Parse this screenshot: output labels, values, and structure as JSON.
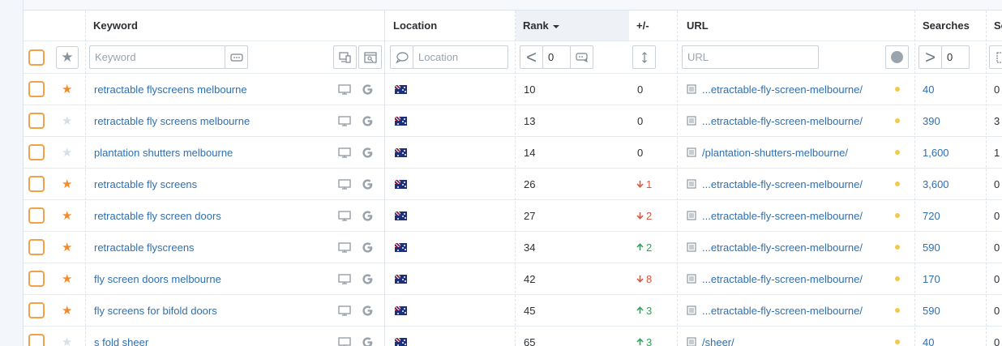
{
  "header": {
    "keyword": "Keyword",
    "location": "Location",
    "rank": "Rank",
    "change": "+/-",
    "url": "URL",
    "searches": "Searches",
    "extra": "Sc"
  },
  "filters": {
    "keyword_placeholder": "Keyword",
    "location_placeholder": "Location",
    "rank_operator": "<",
    "rank_value": "0",
    "url_placeholder": "URL",
    "searches_operator": ">",
    "searches_value": "0"
  },
  "colors": {
    "accent_orange": "#f08c2e",
    "link_blue": "#2f6fb0",
    "down_red": "#e0533f",
    "up_green": "#2ea35b",
    "dot_yellow": "#f3c94a"
  },
  "icons": {
    "device": "desktop-icon",
    "engine": "google-icon",
    "location_flag": "australia-flag-icon",
    "url_doc": "document-icon"
  },
  "rows": [
    {
      "keyword": "retractable flyscreens melbourne",
      "starred": true,
      "rank": "10",
      "change": "0",
      "trend": "none",
      "url": "...etractable-fly-screen-melbourne/",
      "searches": "40",
      "extra": "0"
    },
    {
      "keyword": "retractable fly screens melbourne",
      "starred": false,
      "rank": "13",
      "change": "0",
      "trend": "none",
      "url": "...etractable-fly-screen-melbourne/",
      "searches": "390",
      "extra": "3"
    },
    {
      "keyword": "plantation shutters melbourne",
      "starred": false,
      "rank": "14",
      "change": "0",
      "trend": "none",
      "url": "/plantation-shutters-melbourne/",
      "searches": "1,600",
      "extra": "1"
    },
    {
      "keyword": "retractable fly screens",
      "starred": true,
      "rank": "26",
      "change": "1",
      "trend": "down",
      "url": "...etractable-fly-screen-melbourne/",
      "searches": "3,600",
      "extra": "0"
    },
    {
      "keyword": "retractable fly screen doors",
      "starred": true,
      "rank": "27",
      "change": "2",
      "trend": "down",
      "url": "...etractable-fly-screen-melbourne/",
      "searches": "720",
      "extra": "0"
    },
    {
      "keyword": "retractable flyscreens",
      "starred": true,
      "rank": "34",
      "change": "2",
      "trend": "up",
      "url": "...etractable-fly-screen-melbourne/",
      "searches": "590",
      "extra": "0"
    },
    {
      "keyword": "fly screen doors melbourne",
      "starred": true,
      "rank": "42",
      "change": "8",
      "trend": "down",
      "url": "...etractable-fly-screen-melbourne/",
      "searches": "170",
      "extra": "0"
    },
    {
      "keyword": "fly screens for bifold doors",
      "starred": true,
      "rank": "45",
      "change": "3",
      "trend": "up",
      "url": "...etractable-fly-screen-melbourne/",
      "searches": "590",
      "extra": "0"
    },
    {
      "keyword": "s fold sheer",
      "starred": false,
      "rank": "65",
      "change": "3",
      "trend": "up",
      "url": "/sheer/",
      "searches": "40",
      "extra": "0"
    }
  ]
}
